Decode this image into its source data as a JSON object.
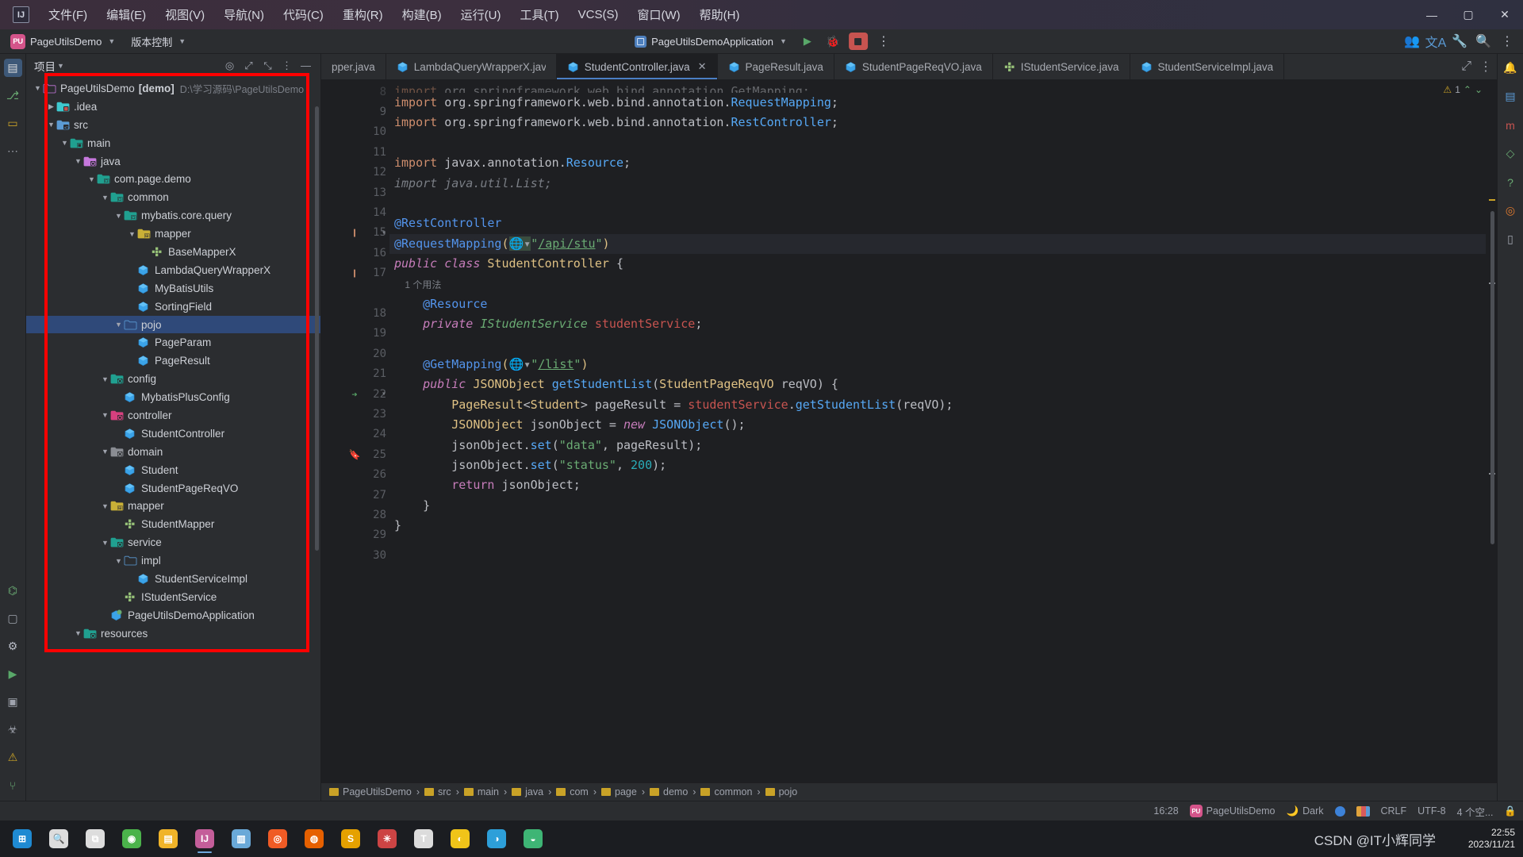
{
  "window": {
    "app_icon_label": "IJ",
    "menu": [
      {
        "label": "文件(F)"
      },
      {
        "label": "编辑(E)"
      },
      {
        "label": "视图(V)"
      },
      {
        "label": "导航(N)"
      },
      {
        "label": "代码(C)"
      },
      {
        "label": "重构(R)"
      },
      {
        "label": "构建(B)"
      },
      {
        "label": "运行(U)"
      },
      {
        "label": "工具(T)"
      },
      {
        "label": "VCS(S)"
      },
      {
        "label": "窗口(W)"
      },
      {
        "label": "帮助(H)"
      }
    ],
    "controls": {
      "minimize": "—",
      "maximize": "▢",
      "close": "✕"
    }
  },
  "toolbar": {
    "project_badge": "PU",
    "project_name": "PageUtilsDemo",
    "vcs_label": "版本控制",
    "run_config": "PageUtilsDemoApplication",
    "run_tooltip": "运行",
    "debug_tooltip": "调试",
    "stop_tooltip": "停止",
    "more_tooltip": "更多",
    "icons": [
      "run-icon",
      "debug-icon",
      "stop-icon",
      "more-vertical-icon",
      "account-icon",
      "translate-icon",
      "settings-icon",
      "search-icon",
      "menu-icon"
    ]
  },
  "left_rail": {
    "items": [
      {
        "name": "project-tool-window",
        "glyph": "▤",
        "selected": true
      },
      {
        "name": "commit-tool-window",
        "glyph": "⎇",
        "selected": false
      },
      {
        "name": "bookmarks-tool-window",
        "glyph": "▭",
        "selected": false
      },
      {
        "name": "more-tool-windows",
        "glyph": "⋯",
        "selected": false
      }
    ],
    "bottom_items": [
      {
        "name": "structure-icon",
        "glyph": "⌬"
      },
      {
        "name": "terminal-panel-icon",
        "glyph": "▢"
      },
      {
        "name": "settings-icon",
        "glyph": "⚙"
      },
      {
        "name": "run-panel-icon",
        "glyph": "▶"
      },
      {
        "name": "debug-panel-icon",
        "glyph": "▣"
      },
      {
        "name": "bug-icon",
        "glyph": "☣"
      },
      {
        "name": "problems-icon",
        "glyph": "⚠"
      },
      {
        "name": "git-icon",
        "glyph": "⑂"
      }
    ]
  },
  "right_rail": {
    "items": [
      {
        "name": "notifications-icon",
        "glyph": "🔔"
      },
      {
        "name": "database-icon",
        "glyph": "▤"
      },
      {
        "name": "maven-icon",
        "glyph": "m"
      },
      {
        "name": "gradle-icon",
        "glyph": "◇"
      },
      {
        "name": "help-icon",
        "glyph": "?"
      },
      {
        "name": "ai-assistant-icon",
        "glyph": "◎"
      },
      {
        "name": "bookmarks-icon",
        "glyph": "▯"
      }
    ]
  },
  "project_panel": {
    "title": "项目",
    "header_icons": [
      "target-icon",
      "expand-icon",
      "collapse-icon",
      "options-icon",
      "hide-icon"
    ],
    "tree": [
      {
        "depth": 0,
        "arrow": "down",
        "icon": "folder-project",
        "label": "PageUtilsDemo",
        "bold_suffix": "[demo]",
        "dim": "D:\\学习源码\\PageUtilsDemo",
        "selected": false
      },
      {
        "depth": 1,
        "arrow": "right",
        "icon": "folder-idea",
        "label": ".idea",
        "selected": false
      },
      {
        "depth": 1,
        "arrow": "down",
        "icon": "folder-src",
        "label": "src",
        "selected": false
      },
      {
        "depth": 2,
        "arrow": "down",
        "icon": "folder-module",
        "label": "main",
        "selected": false
      },
      {
        "depth": 3,
        "arrow": "down",
        "icon": "folder-java",
        "label": "java",
        "selected": false
      },
      {
        "depth": 4,
        "arrow": "down",
        "icon": "folder-package",
        "label": "com.page.demo",
        "selected": false
      },
      {
        "depth": 5,
        "arrow": "down",
        "icon": "folder-package",
        "label": "common",
        "selected": false
      },
      {
        "depth": 6,
        "arrow": "down",
        "icon": "folder-package",
        "label": "mybatis.core.query",
        "selected": false
      },
      {
        "depth": 7,
        "arrow": "down",
        "icon": "folder-yellow",
        "label": "mapper",
        "selected": false
      },
      {
        "depth": 8,
        "arrow": "none",
        "icon": "interface-icon",
        "label": "BaseMapperX",
        "selected": false
      },
      {
        "depth": 7,
        "arrow": "none",
        "icon": "class-icon",
        "label": "LambdaQueryWrapperX",
        "selected": false
      },
      {
        "depth": 7,
        "arrow": "none",
        "icon": "class-icon",
        "label": "MyBatisUtils",
        "selected": false
      },
      {
        "depth": 7,
        "arrow": "none",
        "icon": "class-icon",
        "label": "SortingField",
        "selected": false
      },
      {
        "depth": 6,
        "arrow": "down",
        "icon": "folder-plain",
        "label": "pojo",
        "selected": true
      },
      {
        "depth": 7,
        "arrow": "none",
        "icon": "class-icon",
        "label": "PageParam",
        "selected": false
      },
      {
        "depth": 7,
        "arrow": "none",
        "icon": "class-icon",
        "label": "PageResult",
        "selected": false
      },
      {
        "depth": 5,
        "arrow": "down",
        "icon": "folder-config",
        "label": "config",
        "selected": false
      },
      {
        "depth": 6,
        "arrow": "none",
        "icon": "class-icon",
        "label": "MybatisPlusConfig",
        "selected": false
      },
      {
        "depth": 5,
        "arrow": "down",
        "icon": "folder-controller",
        "label": "controller",
        "selected": false
      },
      {
        "depth": 6,
        "arrow": "none",
        "icon": "class-icon",
        "label": "StudentController",
        "selected": false
      },
      {
        "depth": 5,
        "arrow": "down",
        "icon": "folder-domain",
        "label": "domain",
        "selected": false
      },
      {
        "depth": 6,
        "arrow": "none",
        "icon": "class-icon",
        "label": "Student",
        "selected": false
      },
      {
        "depth": 6,
        "arrow": "none",
        "icon": "class-icon",
        "label": "StudentPageReqVO",
        "selected": false
      },
      {
        "depth": 5,
        "arrow": "down",
        "icon": "folder-yellow",
        "label": "mapper",
        "selected": false
      },
      {
        "depth": 6,
        "arrow": "none",
        "icon": "interface-icon",
        "label": "StudentMapper",
        "selected": false
      },
      {
        "depth": 5,
        "arrow": "down",
        "icon": "folder-service",
        "label": "service",
        "selected": false
      },
      {
        "depth": 6,
        "arrow": "down",
        "icon": "folder-plain",
        "label": "impl",
        "selected": false
      },
      {
        "depth": 7,
        "arrow": "none",
        "icon": "class-icon",
        "label": "StudentServiceImpl",
        "selected": false
      },
      {
        "depth": 6,
        "arrow": "none",
        "icon": "interface-icon",
        "label": "IStudentService",
        "selected": false
      },
      {
        "depth": 5,
        "arrow": "none",
        "icon": "spring-class",
        "label": "PageUtilsDemoApplication",
        "selected": false
      },
      {
        "depth": 3,
        "arrow": "down",
        "icon": "folder-resources",
        "label": "resources",
        "selected": false
      }
    ]
  },
  "editor": {
    "tabs": [
      {
        "label": "pper.java",
        "icon": "interface-icon",
        "active": false,
        "truncated": true
      },
      {
        "label": "LambdaQueryWrapperX.java",
        "icon": "class-icon",
        "active": false
      },
      {
        "label": "StudentController.java",
        "icon": "class-icon",
        "active": true,
        "closable": true
      },
      {
        "label": "PageResult.java",
        "icon": "class-icon",
        "active": false
      },
      {
        "label": "StudentPageReqVO.java",
        "icon": "class-icon",
        "active": false
      },
      {
        "label": "IStudentService.java",
        "icon": "interface-icon",
        "active": false
      },
      {
        "label": "StudentServiceImpl.java",
        "icon": "class-icon",
        "active": false
      }
    ],
    "tab_close_glyph": "✕",
    "inspection_warnings": "1",
    "lines": [
      {
        "num": "8",
        "text": "import org.springframework.web.bind.annotation.GetMapping;",
        "partial": true
      },
      {
        "num": "9",
        "text": "import org.springframework.web.bind.annotation.RequestMapping;"
      },
      {
        "num": "10",
        "text": "import org.springframework.web.bind.annotation.RestController;"
      },
      {
        "num": "11",
        "text": ""
      },
      {
        "num": "12",
        "text": "import javax.annotation.Resource;"
      },
      {
        "num": "13",
        "text": "import java.util.List;"
      },
      {
        "num": "14",
        "text": ""
      },
      {
        "num": "15",
        "text": "@RestController",
        "gutter_icon": "spring-bean-icon",
        "fold": "v"
      },
      {
        "num": "16",
        "text": "@RequestMapping(\"/api/stu\")",
        "highlight": true
      },
      {
        "num": "17",
        "text": "public class StudentController {",
        "gutter_icon": "spring-bean-icon"
      },
      {
        "num": "",
        "text": "1 个用法",
        "usage_hint": true
      },
      {
        "num": "18",
        "text": "@Resource"
      },
      {
        "num": "19",
        "text": "private IStudentService studentService;"
      },
      {
        "num": "20",
        "text": ""
      },
      {
        "num": "21",
        "text": "@GetMapping(\"/list\")"
      },
      {
        "num": "22",
        "text": "public JSONObject getStudentList(StudentPageReqVO reqVO) {",
        "gutter_icon": "override-run-icon",
        "fold": "v"
      },
      {
        "num": "23",
        "text": "PageResult<Student> pageResult = studentService.getStudentList(reqVO);"
      },
      {
        "num": "24",
        "text": "JSONObject jsonObject = new JSONObject();"
      },
      {
        "num": "25",
        "text": "jsonObject.set(\"data\", pageResult);",
        "gutter_icon": "bookmark-icon"
      },
      {
        "num": "26",
        "text": "jsonObject.set(\"status\", 200);"
      },
      {
        "num": "27",
        "text": "return jsonObject;"
      },
      {
        "num": "28",
        "text": "}"
      },
      {
        "num": "29",
        "text": "}"
      },
      {
        "num": "30",
        "text": ""
      }
    ],
    "usage_hint_text": "1 个用法"
  },
  "breadcrumbs": {
    "items": [
      "PageUtilsDemo",
      "src",
      "main",
      "java",
      "com",
      "page",
      "demo",
      "common",
      "pojo"
    ],
    "separator": "›",
    "folder_icon": "folder-icon"
  },
  "status_bar": {
    "time": "16:28",
    "project_badge": "PU",
    "project": "PageUtilsDemo",
    "theme_icon": "moon-icon",
    "theme": "Dark",
    "line_sep": "CRLF",
    "encoding": "UTF-8",
    "indent": "4 个空...",
    "indicator_blue": "#3d82d8",
    "indicator_colors": "#e0a33c"
  },
  "taskbar": {
    "items": [
      {
        "name": "start-button",
        "glyph": "⊞",
        "color": "#1f8ad2",
        "active": false
      },
      {
        "name": "search-button",
        "glyph": "🔍",
        "color": "#dddddd",
        "active": false
      },
      {
        "name": "task-view-button",
        "glyph": "⧉",
        "color": "#dddddd",
        "active": false
      },
      {
        "name": "chrome-icon",
        "glyph": "◉",
        "color": "#4bb34b",
        "active": false
      },
      {
        "name": "file-explorer-icon",
        "glyph": "▤",
        "color": "#f0b429",
        "active": false
      },
      {
        "name": "intellij-idea-icon",
        "glyph": "IJ",
        "color": "#c45e9a",
        "active": true
      },
      {
        "name": "navicat-icon",
        "glyph": "▥",
        "color": "#6aa9d8",
        "active": false
      },
      {
        "name": "postman-icon",
        "glyph": "◎",
        "color": "#ef5b25",
        "active": false
      },
      {
        "name": "firefox-icon",
        "glyph": "◍",
        "color": "#e66000",
        "active": false
      },
      {
        "name": "sublime-icon",
        "glyph": "S",
        "color": "#e5a100",
        "active": false
      },
      {
        "name": "xmind-icon",
        "glyph": "✳",
        "color": "#c44",
        "active": false
      },
      {
        "name": "typora-icon",
        "glyph": "T",
        "color": "#dcdcdc",
        "active": false
      },
      {
        "name": "qq-icon",
        "glyph": "◐",
        "color": "#f0c419",
        "active": false
      },
      {
        "name": "edge-icon",
        "glyph": "◑",
        "color": "#2d9fd9",
        "active": false
      },
      {
        "name": "wechat-icon",
        "glyph": "◒",
        "color": "#3eb575",
        "active": false
      }
    ],
    "clock_time": "22:55",
    "clock_date": "2023/11/21",
    "watermark": "CSDN @IT小辉同学"
  },
  "annotation": {
    "redbox_color": "#ff0000"
  }
}
